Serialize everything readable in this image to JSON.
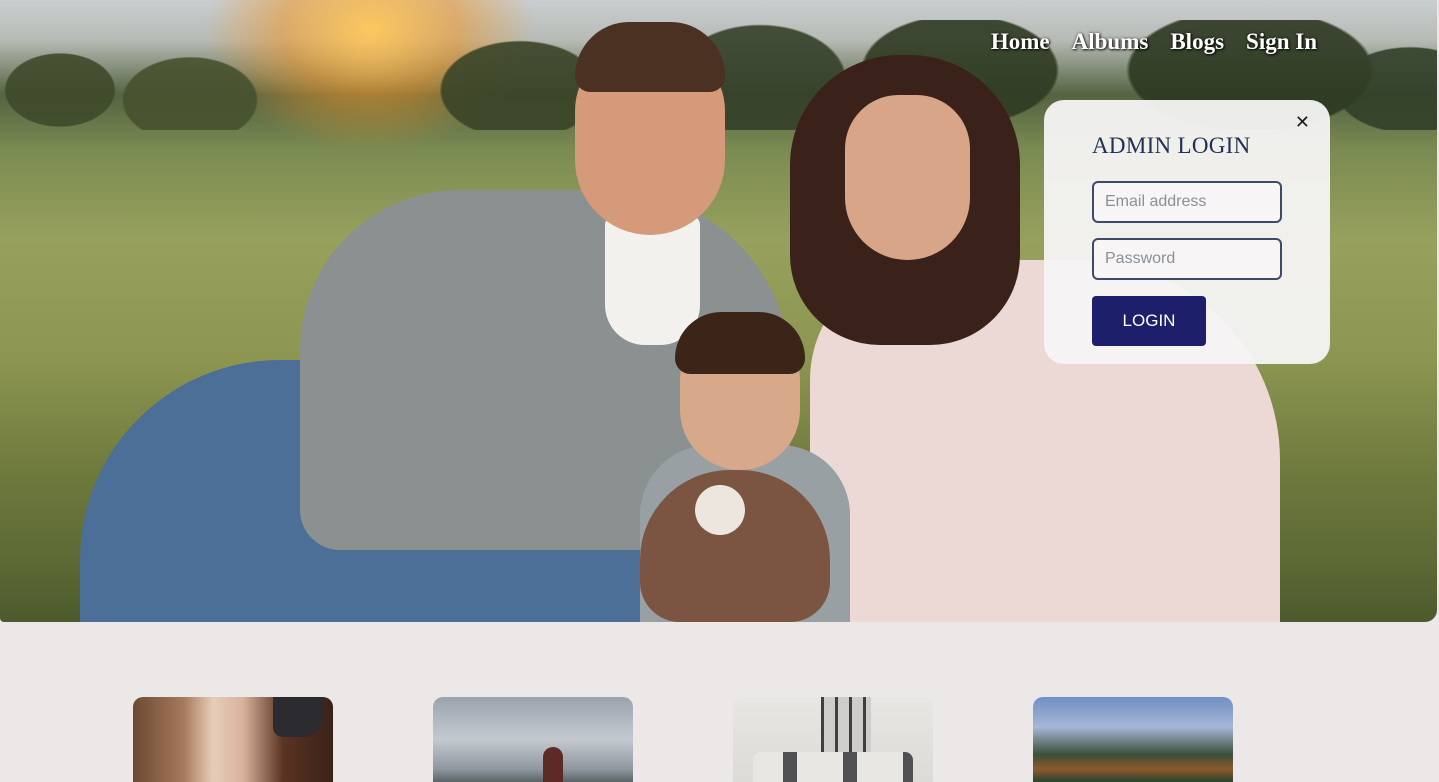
{
  "nav": {
    "items": [
      "Home",
      "Albums",
      "Blogs",
      "Sign In"
    ]
  },
  "login": {
    "title": "ADMIN LOGIN",
    "close_symbol": "✕",
    "email_placeholder": "Email address",
    "password_placeholder": "Password",
    "submit_label": "LOGIN"
  },
  "hero": {
    "image": "family-photo"
  },
  "albums": {
    "cards": [
      "couple-photo",
      "mountain-couple-photo",
      "church-photo",
      "lake-photo"
    ]
  },
  "colors": {
    "background": "#ece8e8",
    "login_title": "#233057",
    "login_button": "#1d1f6a"
  }
}
